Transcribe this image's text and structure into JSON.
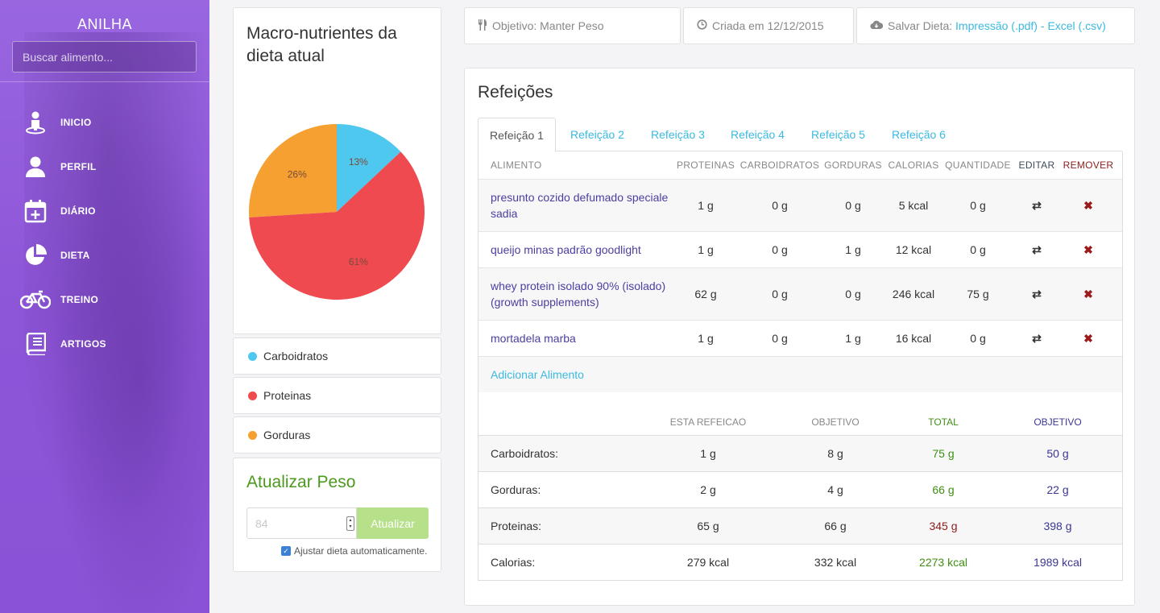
{
  "sidebar": {
    "brand": "ANILHA",
    "search_placeholder": "Buscar alimento...",
    "items": [
      {
        "label": "INICIO",
        "icon": "home-person-icon"
      },
      {
        "label": "PERFIL",
        "icon": "user-icon"
      },
      {
        "label": "DIÁRIO",
        "icon": "calendar-plus-icon"
      },
      {
        "label": "DIETA",
        "icon": "pie-chart-icon"
      },
      {
        "label": "TREINO",
        "icon": "bicycle-icon"
      },
      {
        "label": "ARTIGOS",
        "icon": "book-icon"
      }
    ]
  },
  "macro_card": {
    "title": "Macro-nutrientes da dieta atual",
    "legend": [
      {
        "label": "Carboidratos",
        "color": "#4ec8ee"
      },
      {
        "label": "Proteinas",
        "color": "#ee4a4f"
      },
      {
        "label": "Gorduras",
        "color": "#f5a030"
      }
    ]
  },
  "chart_data": {
    "type": "pie",
    "slices": [
      {
        "label": "13%",
        "value": 13,
        "color": "#4ec8ee"
      },
      {
        "label": "61%",
        "value": 61,
        "color": "#ee4a4f"
      },
      {
        "label": "26%",
        "value": 26,
        "color": "#f5a030"
      }
    ]
  },
  "peso": {
    "title": "Atualizar Peso",
    "input_value": "84",
    "button_label": "Atualizar",
    "checkbox_label": "Ajustar dieta automaticamente."
  },
  "info": {
    "objetivo": "Objetivo: Manter Peso",
    "criada": "Criada em 12/12/2015",
    "salvar_prefix": "Salvar Dieta: ",
    "salvar_pdf": "Impressão (.pdf)",
    "salvar_sep": " - ",
    "salvar_csv": "Excel (.csv)"
  },
  "main": {
    "title": "Refeições",
    "tabs": [
      "Refeição 1",
      "Refeição 2",
      "Refeição 3",
      "Refeição 4",
      "Refeição 5",
      "Refeição 6"
    ],
    "active_tab": 0,
    "columns": [
      "ALIMENTO",
      "PROTEINAS",
      "CARBOIDRATOS",
      "GORDURAS",
      "CALORIAS",
      "QUANTIDADE",
      "EDITAR",
      "REMOVER"
    ],
    "foods": [
      {
        "name": "presunto cozido defumado speciale sadia",
        "proteinas": "1 g",
        "carboidratos": "0 g",
        "gorduras": "0 g",
        "calorias": "5 kcal",
        "quantidade": "0 g"
      },
      {
        "name": "queijo minas padrão goodlight",
        "proteinas": "1 g",
        "carboidratos": "0 g",
        "gorduras": "1 g",
        "calorias": "12 kcal",
        "quantidade": "0 g"
      },
      {
        "name": "whey protein isolado 90% (isolado) (growth supplements)",
        "proteinas": "62 g",
        "carboidratos": "0 g",
        "gorduras": "0 g",
        "calorias": "246 kcal",
        "quantidade": "75 g"
      },
      {
        "name": "mortadela marba",
        "proteinas": "1 g",
        "carboidratos": "0 g",
        "gorduras": "1 g",
        "calorias": "16 kcal",
        "quantidade": "0 g"
      }
    ],
    "add_food": "Adicionar Alimento",
    "totals_columns": [
      "ESTA REFEICAO",
      "OBJETIVO",
      "TOTAL",
      "OBJETIVO"
    ],
    "totals": [
      {
        "label": "Carboidratos:",
        "refeicao": "1 g",
        "objetivo": "8 g",
        "total": "75 g",
        "total_status": "green",
        "objetivo_total": "50 g"
      },
      {
        "label": "Gorduras:",
        "refeicao": "2 g",
        "objetivo": "4 g",
        "total": "66 g",
        "total_status": "green",
        "objetivo_total": "22 g"
      },
      {
        "label": "Proteinas:",
        "refeicao": "65 g",
        "objetivo": "66 g",
        "total": "345 g",
        "total_status": "red",
        "objetivo_total": "398 g"
      },
      {
        "label": "Calorias:",
        "refeicao": "279 kcal",
        "objetivo": "332 kcal",
        "total": "2273 kcal",
        "total_status": "green",
        "objetivo_total": "1989 kcal"
      }
    ]
  }
}
